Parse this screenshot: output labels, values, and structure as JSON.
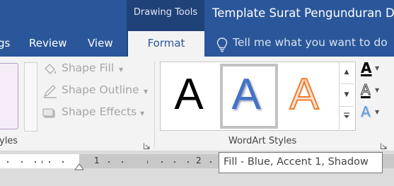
{
  "titlebar": {
    "contextual_group": "Drawing Tools",
    "document_title": "Template Surat Pengunduran Diri",
    "colors": {
      "bar": "#2b579a",
      "contextual": "#1f4278"
    }
  },
  "tabs": {
    "partial_left": "gs",
    "review": "Review",
    "view": "View",
    "active": "Format"
  },
  "tell_me": {
    "placeholder": "Tell me what you want to do",
    "icon": "lightbulb-icon"
  },
  "shape_styles": {
    "commands": [
      {
        "label": "Shape Fill",
        "icon": "paint-bucket-icon"
      },
      {
        "label": "Shape Outline",
        "icon": "pencil-icon"
      },
      {
        "label": "Shape Effects",
        "icon": "shape-effects-icon"
      }
    ],
    "group_label_partial": "yles"
  },
  "wordart_styles": {
    "group_label": "WordArt Styles",
    "items": [
      {
        "glyph": "A",
        "style": "Fill - Black, Text 1, Shadow",
        "color": "#000000"
      },
      {
        "glyph": "A",
        "style": "Fill - Blue, Accent 1, Shadow",
        "color": "#4472c4",
        "selected": true
      },
      {
        "glyph": "A",
        "style": "Fill - Orange, Accent 2, Outline",
        "color": "#f4b183"
      }
    ],
    "text_commands": [
      {
        "glyph": "A",
        "icon": "text-fill-icon"
      },
      {
        "glyph": "A",
        "icon": "text-outline-icon"
      },
      {
        "glyph": "A",
        "icon": "text-effects-icon"
      }
    ]
  },
  "ruler": {
    "numbers": [
      "1",
      "2"
    ]
  },
  "tooltip": {
    "text": "Fill - Blue, Accent 1, Shadow"
  }
}
